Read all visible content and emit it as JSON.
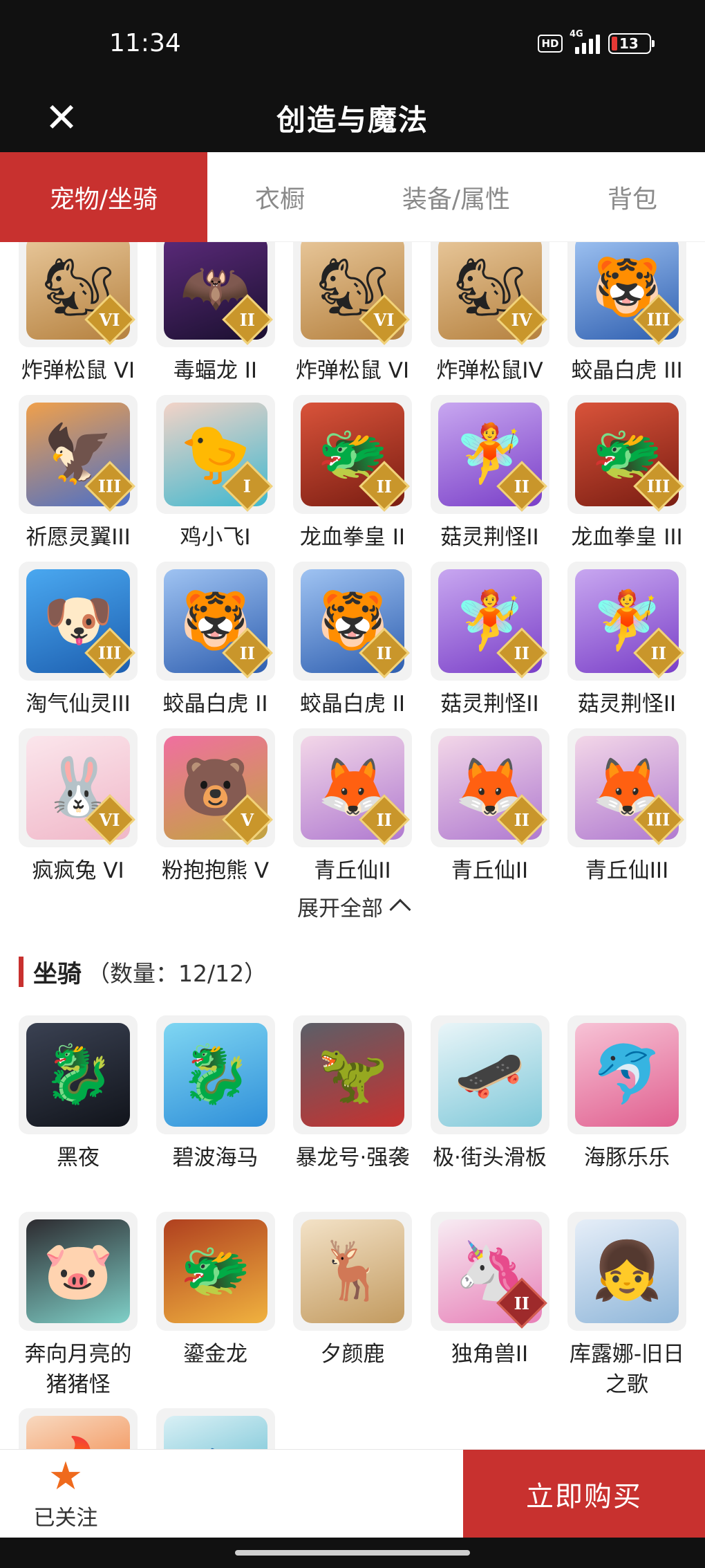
{
  "status_bar": {
    "time": "11:34",
    "hd": "HD",
    "network": "4G",
    "battery": "13"
  },
  "header": {
    "title": "创造与魔法",
    "close_icon": "close-icon"
  },
  "tabs": [
    {
      "label": "宠物/坐骑",
      "active": true
    },
    {
      "label": "衣橱",
      "active": false
    },
    {
      "label": "装备/属性",
      "active": false
    },
    {
      "label": "背包",
      "active": false
    }
  ],
  "pets": [
    {
      "name": "炸弹松鼠 VI",
      "rank": "VI",
      "icon": "squirrel-icon"
    },
    {
      "name": "毒蝠龙 II",
      "rank": "II",
      "icon": "bat-dragon-icon"
    },
    {
      "name": "炸弹松鼠 VI",
      "rank": "VI",
      "icon": "squirrel-icon"
    },
    {
      "name": "炸弹松鼠IV",
      "rank": "IV",
      "icon": "squirrel-icon"
    },
    {
      "name": "蛟晶白虎 III",
      "rank": "III",
      "icon": "white-tiger-icon"
    },
    {
      "name": "祈愿灵翼III",
      "rank": "III",
      "icon": "bird-icon"
    },
    {
      "name": "鸡小飞I",
      "rank": "I",
      "icon": "chick-icon"
    },
    {
      "name": "龙血拳皇 II",
      "rank": "II",
      "icon": "dragon-boxer-icon"
    },
    {
      "name": "菇灵荆怪II",
      "rank": "II",
      "icon": "mushroom-sprite-icon"
    },
    {
      "name": "龙血拳皇 III",
      "rank": "III",
      "icon": "dragon-boxer-icon"
    },
    {
      "name": "淘气仙灵III",
      "rank": "III",
      "icon": "puppy-icon"
    },
    {
      "name": "蛟晶白虎 II",
      "rank": "II",
      "icon": "white-tiger-icon"
    },
    {
      "name": "蛟晶白虎 II",
      "rank": "II",
      "icon": "white-tiger-icon"
    },
    {
      "name": "菇灵荆怪II",
      "rank": "II",
      "icon": "mushroom-sprite-icon"
    },
    {
      "name": "菇灵荆怪II",
      "rank": "II",
      "icon": "mushroom-sprite-icon"
    },
    {
      "name": "疯疯兔 VI",
      "rank": "VI",
      "icon": "rabbit-icon"
    },
    {
      "name": "粉抱抱熊 V",
      "rank": "V",
      "icon": "bear-icon"
    },
    {
      "name": "青丘仙II",
      "rank": "II",
      "icon": "fox-fairy-icon"
    },
    {
      "name": "青丘仙II",
      "rank": "II",
      "icon": "fox-fairy-icon"
    },
    {
      "name": "青丘仙III",
      "rank": "III",
      "icon": "fox-fairy-icon"
    }
  ],
  "expand": {
    "label": "展开全部"
  },
  "mounts_section": {
    "title": "坐骑",
    "count": "（数量：12/12）"
  },
  "mounts": [
    {
      "name": "黑夜",
      "rank": "",
      "icon": "black-dragon-icon"
    },
    {
      "name": "碧波海马",
      "rank": "",
      "icon": "seahorse-icon"
    },
    {
      "name": "暴龙号·强袭",
      "rank": "",
      "icon": "mech-dino-icon"
    },
    {
      "name": "极·街头滑板",
      "rank": "",
      "icon": "skateboard-icon"
    },
    {
      "name": "海豚乐乐",
      "rank": "",
      "icon": "dolphin-icon"
    },
    {
      "name": "奔向月亮的猪猪怪",
      "rank": "",
      "icon": "pig-icon"
    },
    {
      "name": "鎏金龙",
      "rank": "",
      "icon": "golden-dragon-icon"
    },
    {
      "name": "夕颜鹿",
      "rank": "",
      "icon": "deer-icon"
    },
    {
      "name": "独角兽II",
      "rank": "II",
      "icon": "unicorn-icon"
    },
    {
      "name": "库露娜-旧日之歌",
      "rank": "",
      "icon": "kuluna-icon"
    },
    {
      "name": "",
      "rank": "",
      "icon": "phoenix-icon"
    },
    {
      "name": "",
      "rank": "",
      "icon": "fish-mount-icon"
    }
  ],
  "bottom": {
    "follow_label": "已关注",
    "buy_label": "立即购买"
  }
}
